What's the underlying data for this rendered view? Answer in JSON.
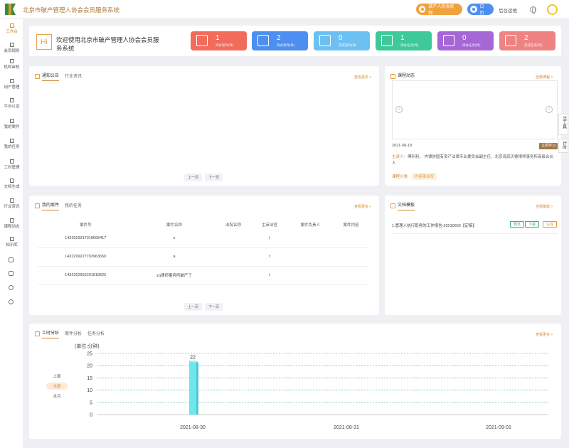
{
  "header": {
    "app_title": "北京市破产管理人协会会员服务系统",
    "btn_portal": "破产人协会官网",
    "btn_calendar": "日历",
    "link_backend": "后台运维"
  },
  "sidebar": {
    "items": [
      {
        "label": "工作台"
      },
      {
        "label": "会员规则"
      },
      {
        "label": "机构审核"
      },
      {
        "label": "用户管理"
      },
      {
        "label": "平台认证"
      },
      {
        "label": "我的案件"
      },
      {
        "label": "我的任务"
      },
      {
        "label": "工时管理"
      },
      {
        "label": "文档生成"
      },
      {
        "label": "行业资讯"
      },
      {
        "label": "课程动态"
      },
      {
        "label": "知识库"
      }
    ]
  },
  "welcome": {
    "hi": "Hi",
    "text": "欢迎使用北京市破产管理人协会会员服务系统",
    "stats": [
      {
        "num": "1",
        "label": "待办案件(件)",
        "color": "#f26b5b"
      },
      {
        "num": "2",
        "label": "待办案件(件)",
        "color": "#4d8ff0"
      },
      {
        "num": "0",
        "label": "完成案件(件)",
        "color": "#6cc0f2"
      },
      {
        "num": "1",
        "label": "待办任务(件)",
        "color": "#3ec99a"
      },
      {
        "num": "0",
        "label": "待办任务(件)",
        "color": "#a766d6"
      },
      {
        "num": "2",
        "label": "完成任务(件)",
        "color": "#ef8383"
      }
    ]
  },
  "notice": {
    "tab1": "通知公告",
    "tab2": "行业资讯",
    "more": "查看更多 >",
    "prev": "上一页",
    "next": "下一页"
  },
  "course": {
    "tab": "课程动态",
    "more": "全部课程 >",
    "date": "2021-08-18",
    "learn": "立即学习",
    "lecturer_label": "主讲人：",
    "lecturer_text": "傅利利， 内律协国有资产法律专业委员会副主任、北京海润天睿律师事务所高级合伙人",
    "category_label": "课程分类:",
    "category": "内容事业所"
  },
  "cases": {
    "tab1": "我的案件",
    "tab2": "我的任务",
    "more": "查看更多 >",
    "columns": [
      "案件号",
      "案件名称",
      "法院名称",
      "主审法官",
      "案件负责人",
      "案件内容"
    ],
    "rows": [
      [
        "1432529317318668417",
        "z",
        "",
        "t",
        "",
        ""
      ],
      [
        "1432299227703963650",
        "a",
        "",
        "t",
        "",
        ""
      ],
      [
        "1432262955201818625",
        "zq律师事务所破产了",
        "",
        "t",
        "",
        ""
      ]
    ],
    "prev": "上一页",
    "next": "下一页"
  },
  "docs": {
    "tab": "文档模板",
    "more": "全部模板 >",
    "item": "1.管理人执行职务的工作报告-20210602【定稿】",
    "preview": "预览",
    "download": "下载",
    "generate": "生成"
  },
  "float_tabs": {
    "a": "法工具",
    "b": "计时"
  },
  "analysis": {
    "tab1": "工时分析",
    "tab2": "案件分析",
    "tab3": "任务分析",
    "more": "查看更多 >",
    "range": [
      "上周",
      "本周",
      "本月"
    ],
    "selected_range": "本周"
  },
  "chart_data": {
    "type": "bar",
    "ylabel": "(单位:分钟)",
    "categories": [
      "2021-08-30",
      "2021-08-31",
      "2021-09-01"
    ],
    "values": [
      22,
      0,
      0
    ],
    "data_labels": [
      "22",
      "",
      ""
    ],
    "ylim": [
      0,
      25
    ],
    "yticks": [
      0,
      5,
      10,
      15,
      20,
      25
    ],
    "grid": true,
    "bar_color": "#6de6ec"
  }
}
